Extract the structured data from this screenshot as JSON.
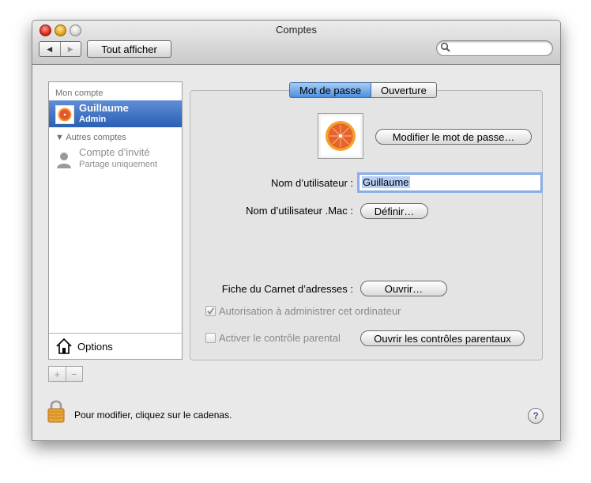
{
  "window": {
    "title": "Comptes"
  },
  "toolbar": {
    "show_all_label": "Tout afficher",
    "back_icon": "left-arrow-icon",
    "forward_icon": "right-arrow-icon",
    "search_placeholder": ""
  },
  "sidebar": {
    "my_account_header": "Mon compte",
    "current_user": {
      "name": "Guillaume",
      "role": "Admin"
    },
    "other_accounts_header": "Autres comptes",
    "guest": {
      "name": "Compte d’invité",
      "subtitle": "Partage uniquement"
    },
    "options_label": "Options",
    "add_label": "+",
    "remove_label": "−"
  },
  "tabs": [
    {
      "label": "Mot de passe",
      "active": true
    },
    {
      "label": "Ouverture",
      "active": false
    }
  ],
  "password_pane": {
    "change_password_button": "Modifier le mot de passe…",
    "username_label": "Nom d’utilisateur :",
    "username_value": "Guillaume",
    "mac_username_label": "Nom d’utilisateur .Mac :",
    "define_button": "Définir…",
    "address_book_label": "Fiche du Carnet d’adresses :",
    "open_button": "Ouvrir…",
    "allow_admin_label": "Autorisation à administrer cet ordinateur",
    "allow_admin_checked": true,
    "parental_label": "Activer le contrôle parental",
    "parental_checked": false,
    "open_parental_button": "Ouvrir les contrôles parentaux"
  },
  "footer": {
    "lock_text": "Pour modifier, cliquez sur le cadenas.",
    "help_label": "?"
  },
  "colors": {
    "selection": "#3d72c4",
    "window_bg": "#e9e9e9",
    "accent_tab": "#5a9be6"
  }
}
